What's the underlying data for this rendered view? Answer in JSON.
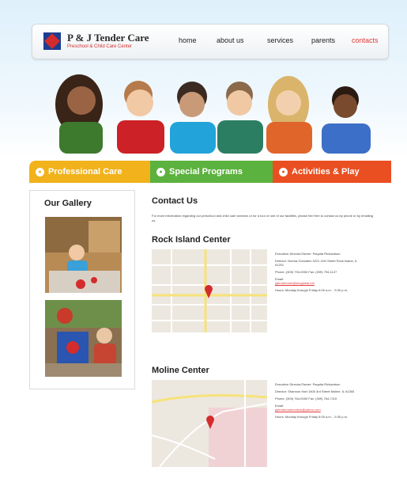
{
  "site": {
    "tagline": "",
    "logo_name": "P & J Tender Care",
    "logo_sub": "Preschool & Child Care Center"
  },
  "nav": {
    "home": "home",
    "about": "about us",
    "services": "services",
    "parents": "parents",
    "contacts": "contacts"
  },
  "tabs": [
    {
      "label": "Professional Care",
      "color": "#f1b21b"
    },
    {
      "label": "Special Programs",
      "color": "#5cb23e"
    },
    {
      "label": "Activities & Play",
      "color": "#ea4f22"
    }
  ],
  "gallery": {
    "title": "Our Gallery"
  },
  "contact": {
    "title": "Contact Us",
    "intro": "For more information regarding our preschool and child care services or for a tour of one of our facilities, please feel free to contact us by phone or by emailing us."
  },
  "centers": [
    {
      "name": "Rock Island Center",
      "lines": [
        "Executive Director/Owner: Paquita Richardson",
        "Director: Norma Gonzalez 3221 11th Street Rock Island, IL 61201",
        "Phone: (309) 794-0000 Fax: (309) 794-1127",
        "Email:",
        "Hours: Monday through Friday 6:00 a.m. - 5:30 p.m."
      ],
      "email": "pjtendercare@sbcglobal.net"
    },
    {
      "name": "Moline Center",
      "lines": [
        "Executive Director/Owner: Paquita Richardson",
        "Director: Shannon Hart 1500 3rd Street Moline, IL 61265",
        "Phone: (309) 764-0000 Fax: (309) 764-7110",
        "Email:",
        "Hours: Monday through Friday 6:00 a.m. - 5:30 p.m."
      ],
      "email": "pjtendercaremoline@yahoo.com"
    }
  ],
  "colors": {
    "accent_red": "#e03a3a",
    "care_yellow": "#f1b21b",
    "programs_green": "#5cb23e",
    "activities_orange": "#ea4f22"
  }
}
